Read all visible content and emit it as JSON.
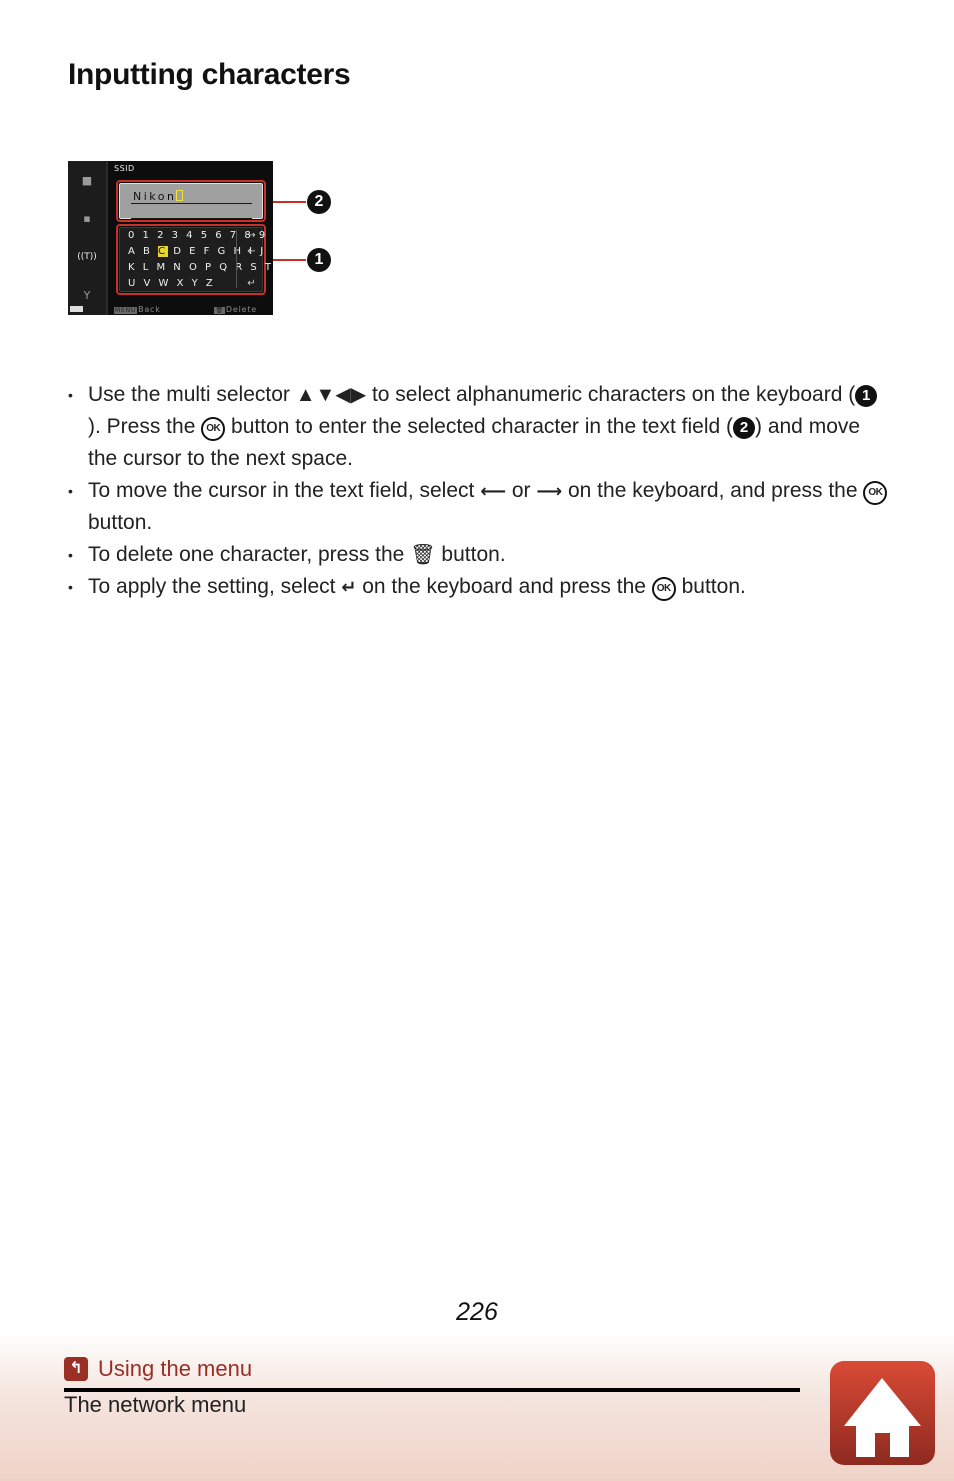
{
  "page": {
    "title": "Inputting characters",
    "page_number": "226"
  },
  "figure": {
    "screen_title": "SSID",
    "text_field_value": "Nikon",
    "keyboard_rows": [
      "0 1 2 3 4 5 6 7 8 9",
      "A B C D E F G H I J",
      "K L M N O P Q R S T",
      "U V W X Y Z"
    ],
    "keyboard_row2_before": "A B ",
    "keyboard_row2_selected": "C",
    "keyboard_row2_after": " D E F G H I J",
    "side_keys": [
      "→",
      "←",
      "↵"
    ],
    "footer_left_key": "MENU",
    "footer_left": "Back",
    "footer_right_key": "🗑",
    "footer_right": "Delete",
    "callouts": [
      "2",
      "1"
    ],
    "sidebar_icons": [
      "camera-icon",
      "movie-camera-icon",
      "wireless-icon",
      "wrench-icon"
    ]
  },
  "bullets": [
    {
      "parts": [
        "Use the multi selector ",
        " to select alphanumeric characters on the keyboard (",
        "). Press the ",
        " button to enter the selected character in the text field (",
        ") and move the cursor to the next space."
      ],
      "arrows": "▲▼◀▶",
      "num1": "1",
      "num2": "2",
      "ok": "OK"
    },
    {
      "parts": [
        "To move the cursor in the text field, select ",
        " or ",
        " on the keyboard, and press the ",
        " button."
      ],
      "left_arrow": "⟵",
      "right_arrow": "⟶",
      "ok": "OK"
    },
    {
      "parts": [
        "To delete one character, press the ",
        " button."
      ],
      "trash": "🗑"
    },
    {
      "parts": [
        "To apply the setting, select ",
        " on the keyboard and press the ",
        " button."
      ],
      "enter": "↵",
      "ok": "OK"
    }
  ],
  "footer": {
    "section_link": "Using the menu",
    "section_icon": "↰",
    "subsection": "The network menu",
    "home_label": "home"
  },
  "colors": {
    "accent_red": "#c8302a",
    "breadcrumb_red": "#9a2e25"
  }
}
